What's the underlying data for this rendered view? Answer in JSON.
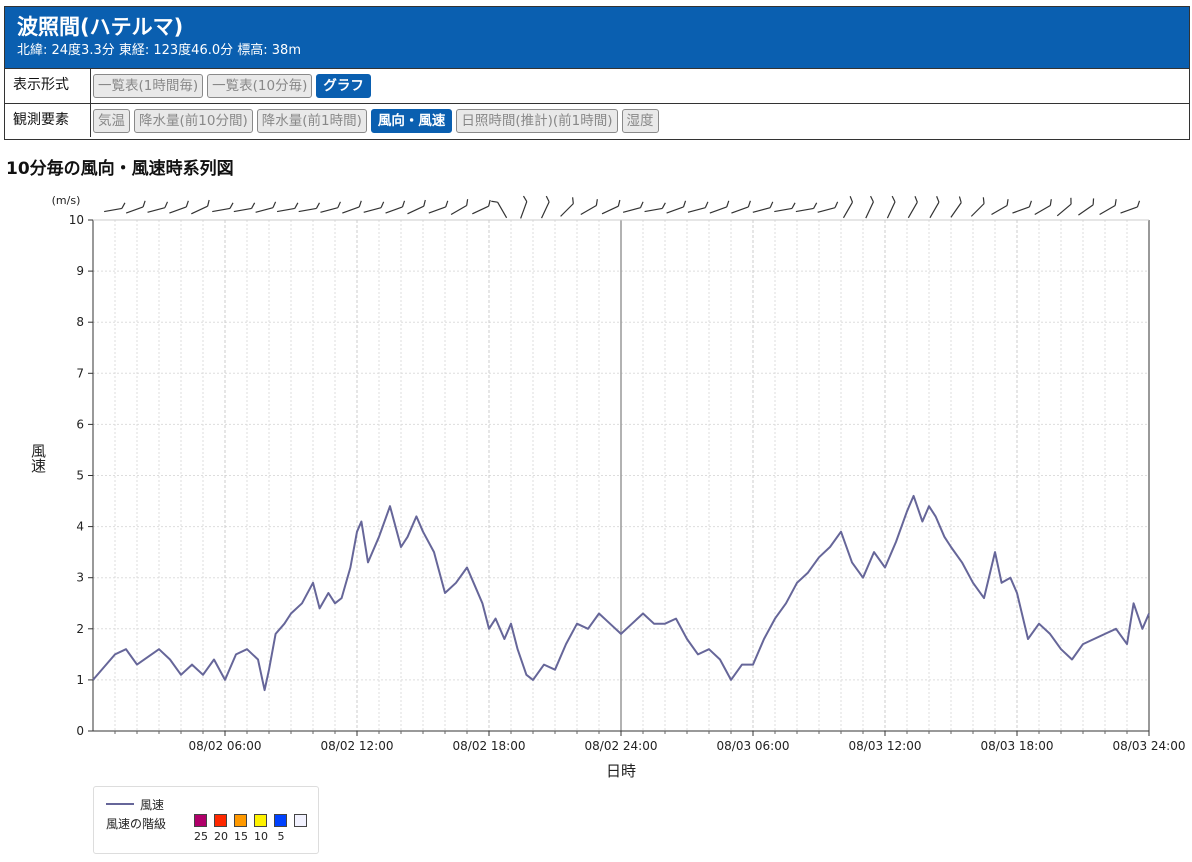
{
  "station": {
    "name": "波照間(ハテルマ)",
    "info": "北緯: 24度3.3分 東経: 123度46.0分 標高: 38m"
  },
  "display_format": {
    "label": "表示形式",
    "buttons": [
      {
        "label": "一覧表(1時間毎)",
        "active": false
      },
      {
        "label": "一覧表(10分毎)",
        "active": false
      },
      {
        "label": "グラフ",
        "active": true
      }
    ]
  },
  "elements": {
    "label": "観測要素",
    "buttons": [
      {
        "label": "気温",
        "active": false
      },
      {
        "label": "降水量(前10分間)",
        "active": false
      },
      {
        "label": "降水量(前1時間)",
        "active": false
      },
      {
        "label": "風向・風速",
        "active": true
      },
      {
        "label": "日照時間(推計)(前1時間)",
        "active": false
      },
      {
        "label": "湿度",
        "active": false
      }
    ]
  },
  "chart_title": "10分毎の風向・風速時系列図",
  "legend": {
    "series_label": "風速",
    "scale_label": "風速の階級",
    "classes": [
      {
        "label": "25",
        "color": "#b0006a"
      },
      {
        "label": "20",
        "color": "#ff2800"
      },
      {
        "label": "15",
        "color": "#ff9900"
      },
      {
        "label": "10",
        "color": "#fff200"
      },
      {
        "label": "5",
        "color": "#0041ff"
      },
      {
        "label": "",
        "color": "#f2f2ff"
      }
    ]
  },
  "chart_data": {
    "type": "line",
    "title": "10分毎の風向・風速時系列図",
    "xlabel": "日時",
    "ylabel": "風速",
    "yunit": "(m/s)",
    "ylim": [
      0,
      10
    ],
    "yticks": [
      0,
      1,
      2,
      3,
      4,
      5,
      6,
      7,
      8,
      9,
      10
    ],
    "xlim_hours": [
      0,
      48
    ],
    "xticks": [
      {
        "hour": 6,
        "label": "08/02 06:00"
      },
      {
        "hour": 12,
        "label": "08/02 12:00"
      },
      {
        "hour": 18,
        "label": "08/02 18:00"
      },
      {
        "hour": 24,
        "label": "08/02 24:00"
      },
      {
        "hour": 30,
        "label": "08/03 06:00"
      },
      {
        "hour": 36,
        "label": "08/03 12:00"
      },
      {
        "hour": 42,
        "label": "08/03 18:00"
      },
      {
        "hour": 48,
        "label": "08/03 24:00"
      }
    ],
    "grid": true,
    "series": [
      {
        "name": "風速",
        "color": "#666699",
        "x_hours": [
          0,
          1,
          1.5,
          2,
          3,
          3.5,
          4,
          4.5,
          5,
          5.5,
          6,
          6.5,
          7,
          7.5,
          7.8,
          8,
          8.3,
          8.7,
          9,
          9.5,
          10,
          10.3,
          10.7,
          11,
          11.3,
          11.7,
          12,
          12.2,
          12.5,
          13,
          13.5,
          14,
          14.3,
          14.7,
          15,
          15.5,
          16,
          16.5,
          17,
          17.3,
          17.7,
          18,
          18.3,
          18.7,
          19,
          19.3,
          19.7,
          20,
          20.5,
          21,
          21.5,
          22,
          22.5,
          23,
          23.5,
          24,
          24.5,
          25,
          25.5,
          26,
          26.5,
          27,
          27.5,
          28,
          28.5,
          29,
          29.5,
          30,
          30.5,
          31,
          31.5,
          32,
          32.5,
          33,
          33.5,
          34,
          34.5,
          35,
          35.5,
          36,
          36.5,
          37,
          37.3,
          37.7,
          38,
          38.3,
          38.7,
          39,
          39.5,
          40,
          40.5,
          41,
          41.3,
          41.7,
          42,
          42.5,
          43,
          43.5,
          44,
          44.5,
          45,
          45.5,
          46,
          46.5,
          47,
          47.3,
          47.7,
          48
        ],
        "values": [
          1.0,
          1.5,
          1.6,
          1.3,
          1.6,
          1.4,
          1.1,
          1.3,
          1.1,
          1.4,
          1.0,
          1.5,
          1.6,
          1.4,
          0.8,
          1.2,
          1.9,
          2.1,
          2.3,
          2.5,
          2.9,
          2.4,
          2.7,
          2.5,
          2.6,
          3.2,
          3.9,
          4.1,
          3.3,
          3.8,
          4.4,
          3.6,
          3.8,
          4.2,
          3.9,
          3.5,
          2.7,
          2.9,
          3.2,
          2.9,
          2.5,
          2.0,
          2.2,
          1.8,
          2.1,
          1.6,
          1.1,
          1.0,
          1.3,
          1.2,
          1.7,
          2.1,
          2.0,
          2.3,
          2.1,
          1.9,
          2.1,
          2.3,
          2.1,
          2.1,
          2.2,
          1.8,
          1.5,
          1.6,
          1.4,
          1.0,
          1.3,
          1.3,
          1.8,
          2.2,
          2.5,
          2.9,
          3.1,
          3.4,
          3.6,
          3.9,
          3.3,
          3.0,
          3.5,
          3.2,
          3.7,
          4.3,
          4.6,
          4.1,
          4.4,
          4.2,
          3.8,
          3.6,
          3.3,
          2.9,
          2.6,
          3.5,
          2.9,
          3.0,
          2.7,
          1.8,
          2.1,
          1.9,
          1.6,
          1.4,
          1.7,
          1.8,
          1.9,
          2.0,
          1.7,
          2.5,
          2.0,
          2.3
        ]
      }
    ],
    "wind_barbs": {
      "count": 48,
      "angles_deg": [
        80,
        70,
        75,
        70,
        65,
        80,
        80,
        75,
        80,
        80,
        75,
        70,
        75,
        70,
        65,
        70,
        60,
        65,
        -30,
        20,
        25,
        45,
        60,
        65,
        75,
        80,
        70,
        75,
        70,
        70,
        75,
        80,
        80,
        75,
        30,
        25,
        25,
        30,
        30,
        35,
        45,
        60,
        70,
        60,
        50,
        55,
        60,
        70
      ]
    }
  }
}
